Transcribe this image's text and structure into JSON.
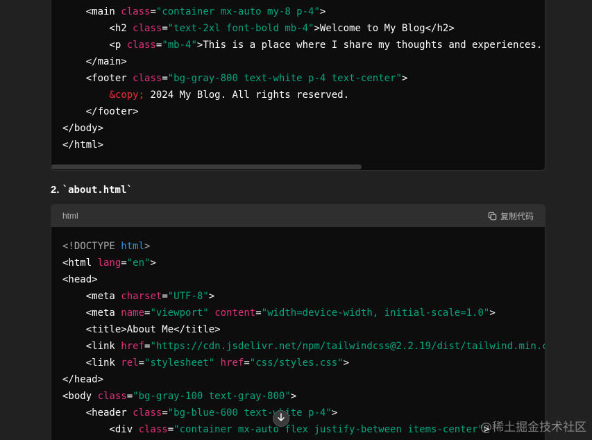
{
  "top_code": {
    "lines": [
      [
        {
          "t": "    <main ",
          "c": "tag"
        },
        {
          "t": "class",
          "c": "attr"
        },
        {
          "t": "=",
          "c": "tag"
        },
        {
          "t": "\"container mx-auto my-8 p-4\"",
          "c": "str"
        },
        {
          "t": ">",
          "c": "tag"
        }
      ],
      [
        {
          "t": "        <h2 ",
          "c": "tag"
        },
        {
          "t": "class",
          "c": "attr"
        },
        {
          "t": "=",
          "c": "tag"
        },
        {
          "t": "\"text-2xl font-bold mb-4\"",
          "c": "str"
        },
        {
          "t": ">Welcome to My Blog</h2>",
          "c": "tag"
        }
      ],
      [
        {
          "t": "        <p ",
          "c": "tag"
        },
        {
          "t": "class",
          "c": "attr"
        },
        {
          "t": "=",
          "c": "tag"
        },
        {
          "t": "\"mb-4\"",
          "c": "str"
        },
        {
          "t": ">This is a place where I share my thoughts and experiences.",
          "c": "tag"
        }
      ],
      [
        {
          "t": "    </main>",
          "c": "tag"
        }
      ],
      [
        {
          "t": "    <footer ",
          "c": "tag"
        },
        {
          "t": "class",
          "c": "attr"
        },
        {
          "t": "=",
          "c": "tag"
        },
        {
          "t": "\"bg-gray-800 text-white p-4 text-center\"",
          "c": "str"
        },
        {
          "t": ">",
          "c": "tag"
        }
      ],
      [
        {
          "t": "        ",
          "c": "tag"
        },
        {
          "t": "&copy;",
          "c": "ent"
        },
        {
          "t": " 2024 My Blog. All rights reserved.",
          "c": "tag"
        }
      ],
      [
        {
          "t": "    </footer>",
          "c": "tag"
        }
      ],
      [
        {
          "t": "</body>",
          "c": "tag"
        }
      ],
      [
        {
          "t": "</html>",
          "c": "tag"
        }
      ]
    ]
  },
  "section": {
    "number": "2.",
    "filename": "`about.html`"
  },
  "bottom_code": {
    "language": "html",
    "copy_label": "复制代码",
    "lines": [
      [
        {
          "t": "<!DOCTYPE ",
          "c": "com"
        },
        {
          "t": "html",
          "c": "kw"
        },
        {
          "t": ">",
          "c": "com"
        }
      ],
      [
        {
          "t": "<html ",
          "c": "tag"
        },
        {
          "t": "lang",
          "c": "attr"
        },
        {
          "t": "=",
          "c": "tag"
        },
        {
          "t": "\"en\"",
          "c": "str"
        },
        {
          "t": ">",
          "c": "tag"
        }
      ],
      [
        {
          "t": "<head>",
          "c": "tag"
        }
      ],
      [
        {
          "t": "    <meta ",
          "c": "tag"
        },
        {
          "t": "charset",
          "c": "attr"
        },
        {
          "t": "=",
          "c": "tag"
        },
        {
          "t": "\"UTF-8\"",
          "c": "str"
        },
        {
          "t": ">",
          "c": "tag"
        }
      ],
      [
        {
          "t": "    <meta ",
          "c": "tag"
        },
        {
          "t": "name",
          "c": "attr"
        },
        {
          "t": "=",
          "c": "tag"
        },
        {
          "t": "\"viewport\"",
          "c": "str"
        },
        {
          "t": " ",
          "c": "tag"
        },
        {
          "t": "content",
          "c": "attr"
        },
        {
          "t": "=",
          "c": "tag"
        },
        {
          "t": "\"width=device-width, initial-scale=1.0\"",
          "c": "str"
        },
        {
          "t": ">",
          "c": "tag"
        }
      ],
      [
        {
          "t": "    <title>About Me</title>",
          "c": "tag"
        }
      ],
      [
        {
          "t": "    <link ",
          "c": "tag"
        },
        {
          "t": "href",
          "c": "attr"
        },
        {
          "t": "=",
          "c": "tag"
        },
        {
          "t": "\"https://cdn.jsdelivr.net/npm/tailwindcss@2.2.19/dist/tailwind.min.c",
          "c": "str"
        }
      ],
      [
        {
          "t": "    <link ",
          "c": "tag"
        },
        {
          "t": "rel",
          "c": "attr"
        },
        {
          "t": "=",
          "c": "tag"
        },
        {
          "t": "\"stylesheet\"",
          "c": "str"
        },
        {
          "t": " ",
          "c": "tag"
        },
        {
          "t": "href",
          "c": "attr"
        },
        {
          "t": "=",
          "c": "tag"
        },
        {
          "t": "\"css/styles.css\"",
          "c": "str"
        },
        {
          "t": ">",
          "c": "tag"
        }
      ],
      [
        {
          "t": "</head>",
          "c": "tag"
        }
      ],
      [
        {
          "t": "<body ",
          "c": "tag"
        },
        {
          "t": "class",
          "c": "attr"
        },
        {
          "t": "=",
          "c": "tag"
        },
        {
          "t": "\"bg-gray-100 text-gray-800\"",
          "c": "str"
        },
        {
          "t": ">",
          "c": "tag"
        }
      ],
      [
        {
          "t": "    <header ",
          "c": "tag"
        },
        {
          "t": "class",
          "c": "attr"
        },
        {
          "t": "=",
          "c": "tag"
        },
        {
          "t": "\"bg-blue-600 text-white p-4\"",
          "c": "str"
        },
        {
          "t": ">",
          "c": "tag"
        }
      ],
      [
        {
          "t": "        <div ",
          "c": "tag"
        },
        {
          "t": "class",
          "c": "attr"
        },
        {
          "t": "=",
          "c": "tag"
        },
        {
          "t": "\"container mx-auto flex justify-between items-center\"",
          "c": "str"
        },
        {
          "t": ">",
          "c": "tag"
        }
      ]
    ]
  },
  "watermark": "@稀土掘金技术社区",
  "icons": {
    "copy": "copy-icon",
    "scroll": "arrow-down-icon"
  }
}
